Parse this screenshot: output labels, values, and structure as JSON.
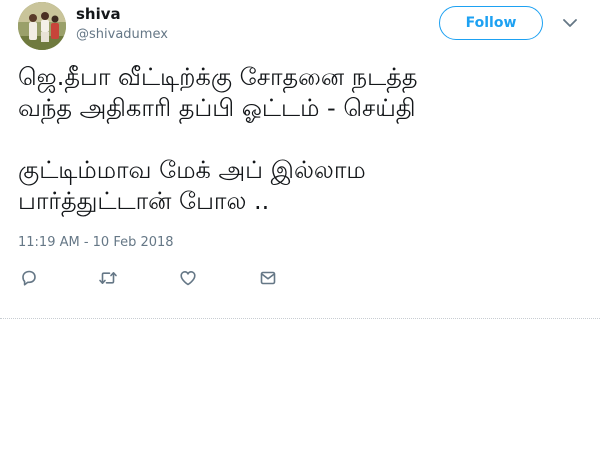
{
  "user": {
    "name": "shiva",
    "handle": "@shivadumex"
  },
  "follow_button": {
    "label": "Follow"
  },
  "tweet": {
    "text": "ஜெ.தீபா வீட்டிற்க்கு சோதனை நடத்த\nவந்த அதிகாரி தப்பி ஓட்டம் - செய்தி\n\nகுட்டிம்மாவ மேக் அப் இல்லாம\nபார்த்துட்டான் போல ..",
    "timestamp": "11:19 AM - 10 Feb 2018"
  },
  "actions": [
    "reply-icon",
    "retweet-icon",
    "like-icon",
    "message-icon"
  ],
  "colors": {
    "accent": "#1da1f2",
    "secondary_text": "#657786",
    "primary_text": "#14171a"
  }
}
